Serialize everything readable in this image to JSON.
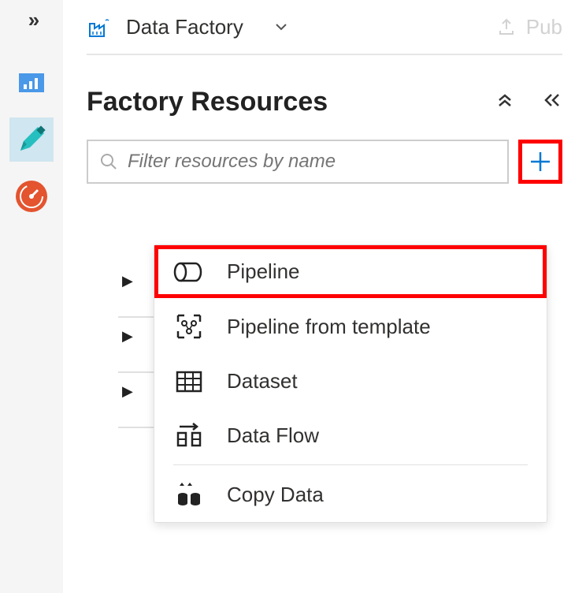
{
  "breadcrumb": {
    "label": "Data Factory"
  },
  "header": {
    "publish_label": "Pub"
  },
  "section": {
    "title": "Factory Resources"
  },
  "filter": {
    "placeholder": "Filter resources by name"
  },
  "menu": {
    "pipeline": "Pipeline",
    "pipeline_template": "Pipeline from template",
    "dataset": "Dataset",
    "data_flow": "Data Flow",
    "copy_data": "Copy Data"
  }
}
